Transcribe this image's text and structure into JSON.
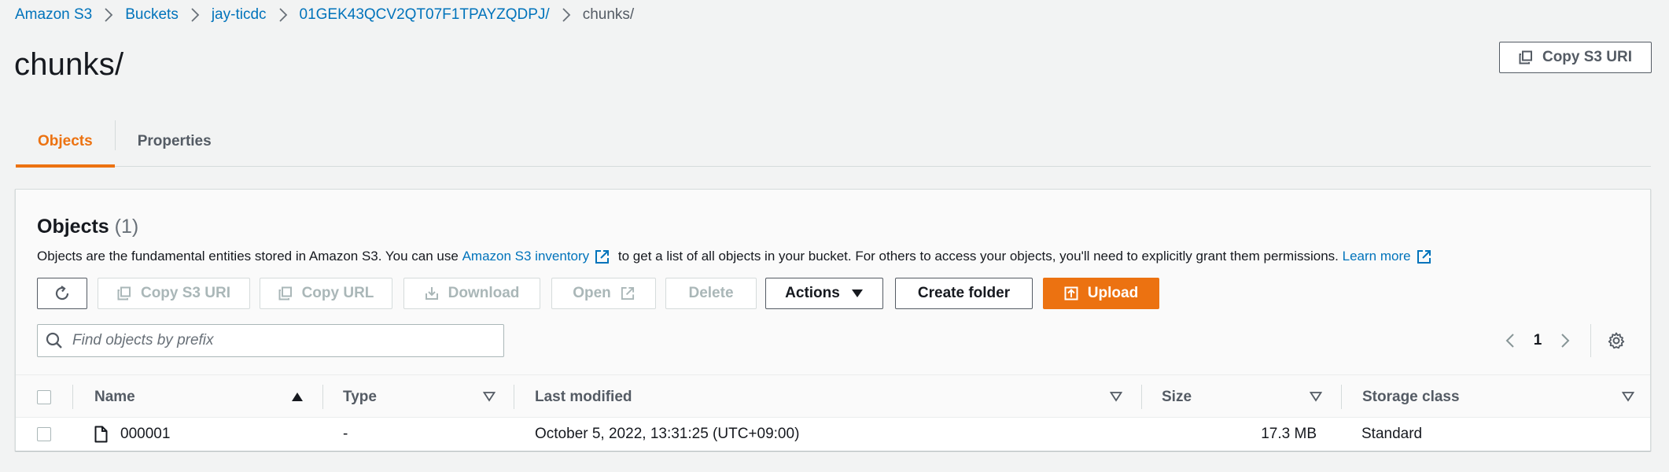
{
  "breadcrumb": [
    "Amazon S3",
    "Buckets",
    "jay-ticdc",
    "01GEK43QCV2QT07F1TPAYZQDPJ/",
    "chunks/"
  ],
  "page_title": "chunks/",
  "copy_s3_uri_top": "Copy S3 URI",
  "tabs": [
    "Objects",
    "Properties"
  ],
  "objects_section": {
    "title": "Objects",
    "count": "(1)",
    "desc_part1": "Objects are the fundamental entities stored in Amazon S3. You can use ",
    "inventory_link": "Amazon S3 inventory",
    "desc_part2": " to get a list of all objects in your bucket. For others to access your objects, you'll need to explicitly grant them permissions. ",
    "learn_more": "Learn more"
  },
  "toolbar": {
    "copy_s3_uri": "Copy S3 URI",
    "copy_url": "Copy URL",
    "download": "Download",
    "open": "Open",
    "delete": "Delete",
    "actions": "Actions",
    "create_folder": "Create folder",
    "upload": "Upload"
  },
  "search": {
    "placeholder": "Find objects by prefix"
  },
  "pagination": {
    "page": "1"
  },
  "table": {
    "columns": [
      "Name",
      "Type",
      "Last modified",
      "Size",
      "Storage class"
    ],
    "rows": [
      {
        "name": "000001",
        "type": "-",
        "last_modified": "October 5, 2022, 13:31:25 (UTC+09:00)",
        "size": "17.3 MB",
        "storage_class": "Standard"
      }
    ]
  },
  "colors": {
    "accent": "#ec7211",
    "link": "#0073bb"
  }
}
